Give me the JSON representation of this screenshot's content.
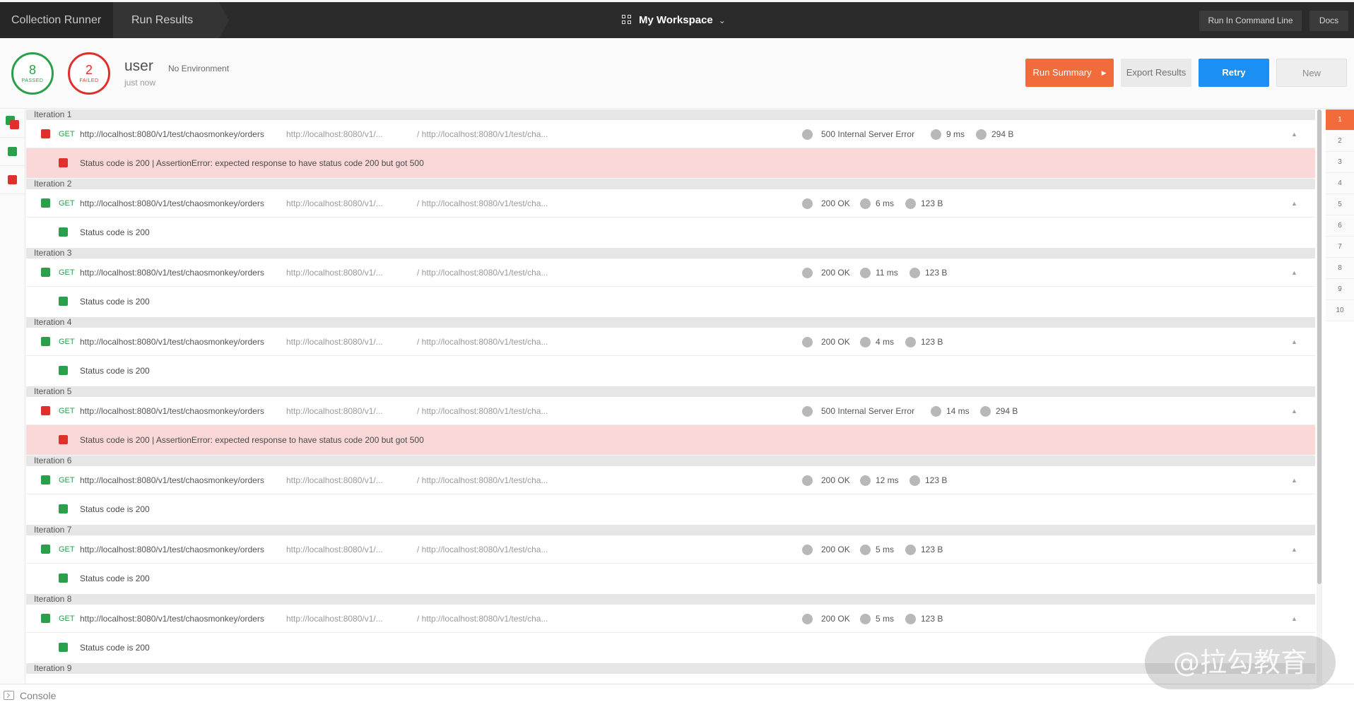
{
  "topbar": {
    "crumb_runner": "Collection Runner",
    "crumb_results": "Run Results",
    "workspace": "My Workspace",
    "cmdline_label": "Run In Command Line",
    "docs_label": "Docs"
  },
  "summary": {
    "passed_count": "8",
    "passed_label": "PASSED",
    "failed_count": "2",
    "failed_label": "FAILED",
    "run_name": "user",
    "run_time": "just now",
    "environment": "No Environment",
    "run_summary_label": "Run Summary",
    "export_label": "Export Results",
    "retry_label": "Retry",
    "new_label": "New"
  },
  "iterations": [
    {
      "title": "Iteration 1",
      "status": "fail",
      "method": "GET",
      "url": "http://localhost:8080/v1/test/chaosmonkey/orders",
      "url_short": "http://localhost:8080/v1/...",
      "url_path": "/ http://localhost:8080/v1/test/cha...",
      "code": "500 Internal Server Error",
      "time": "9 ms",
      "size": "294 B",
      "test": "Status code is 200 | AssertionError: expected response to have status code 200 but got 500"
    },
    {
      "title": "Iteration 2",
      "status": "pass",
      "method": "GET",
      "url": "http://localhost:8080/v1/test/chaosmonkey/orders",
      "url_short": "http://localhost:8080/v1/...",
      "url_path": "/ http://localhost:8080/v1/test/cha...",
      "code": "200 OK",
      "time": "6 ms",
      "size": "123 B",
      "test": "Status code is 200"
    },
    {
      "title": "Iteration 3",
      "status": "pass",
      "method": "GET",
      "url": "http://localhost:8080/v1/test/chaosmonkey/orders",
      "url_short": "http://localhost:8080/v1/...",
      "url_path": "/ http://localhost:8080/v1/test/cha...",
      "code": "200 OK",
      "time": "11 ms",
      "size": "123 B",
      "test": "Status code is 200"
    },
    {
      "title": "Iteration 4",
      "status": "pass",
      "method": "GET",
      "url": "http://localhost:8080/v1/test/chaosmonkey/orders",
      "url_short": "http://localhost:8080/v1/...",
      "url_path": "/ http://localhost:8080/v1/test/cha...",
      "code": "200 OK",
      "time": "4 ms",
      "size": "123 B",
      "test": "Status code is 200"
    },
    {
      "title": "Iteration 5",
      "status": "fail",
      "method": "GET",
      "url": "http://localhost:8080/v1/test/chaosmonkey/orders",
      "url_short": "http://localhost:8080/v1/...",
      "url_path": "/ http://localhost:8080/v1/test/cha...",
      "code": "500 Internal Server Error",
      "time": "14 ms",
      "size": "294 B",
      "test": "Status code is 200 | AssertionError: expected response to have status code 200 but got 500"
    },
    {
      "title": "Iteration 6",
      "status": "pass",
      "method": "GET",
      "url": "http://localhost:8080/v1/test/chaosmonkey/orders",
      "url_short": "http://localhost:8080/v1/...",
      "url_path": "/ http://localhost:8080/v1/test/cha...",
      "code": "200 OK",
      "time": "12 ms",
      "size": "123 B",
      "test": "Status code is 200"
    },
    {
      "title": "Iteration 7",
      "status": "pass",
      "method": "GET",
      "url": "http://localhost:8080/v1/test/chaosmonkey/orders",
      "url_short": "http://localhost:8080/v1/...",
      "url_path": "/ http://localhost:8080/v1/test/cha...",
      "code": "200 OK",
      "time": "5 ms",
      "size": "123 B",
      "test": "Status code is 200"
    },
    {
      "title": "Iteration 8",
      "status": "pass",
      "method": "GET",
      "url": "http://localhost:8080/v1/test/chaosmonkey/orders",
      "url_short": "http://localhost:8080/v1/...",
      "url_path": "/ http://localhost:8080/v1/test/cha...",
      "code": "200 OK",
      "time": "5 ms",
      "size": "123 B",
      "test": "Status code is 200"
    },
    {
      "title": "Iteration 9"
    }
  ],
  "iteration_index": [
    "1",
    "2",
    "3",
    "4",
    "5",
    "6",
    "7",
    "8",
    "9",
    "10"
  ],
  "console_label": "Console",
  "watermark": "@拉勾教育",
  "colors": {
    "pass": "#29a049",
    "fail": "#e0302c",
    "accent": "#f26b3a",
    "retry": "#1b8ff4"
  }
}
